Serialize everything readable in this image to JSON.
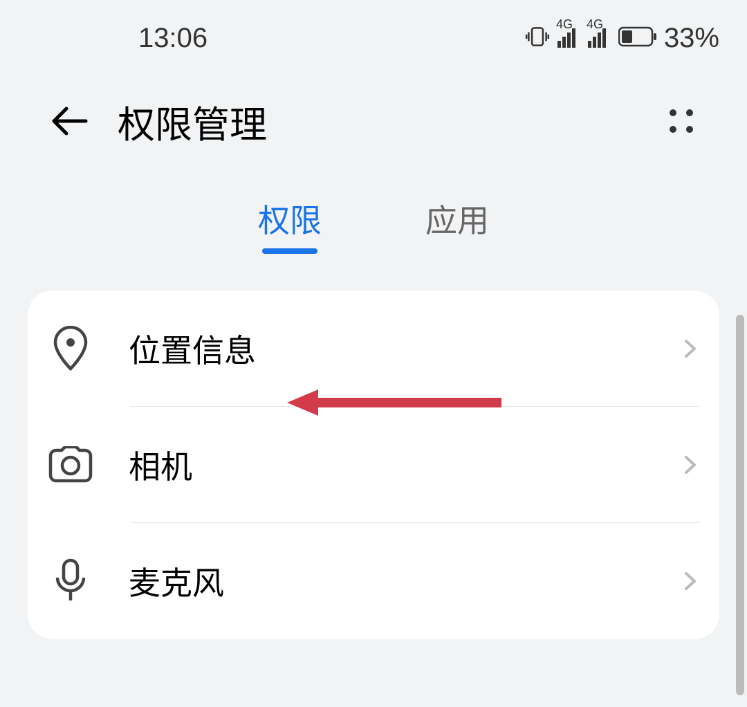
{
  "status_bar": {
    "time": "13:06",
    "battery_percent": "33%",
    "network_label_1": "4G",
    "network_label_2": "4G"
  },
  "header": {
    "title": "权限管理",
    "back_icon": "back-arrow-icon",
    "more_icon": "more-dots-icon"
  },
  "tabs": {
    "permissions": "权限",
    "apps": "应用",
    "active_index": 0
  },
  "permissions_list": [
    {
      "icon": "location-icon",
      "label": "位置信息"
    },
    {
      "icon": "camera-icon",
      "label": "相机"
    },
    {
      "icon": "microphone-icon",
      "label": "麦克风"
    }
  ],
  "colors": {
    "accent": "#1a73e8",
    "annotation_arrow": "#d13b4a"
  }
}
